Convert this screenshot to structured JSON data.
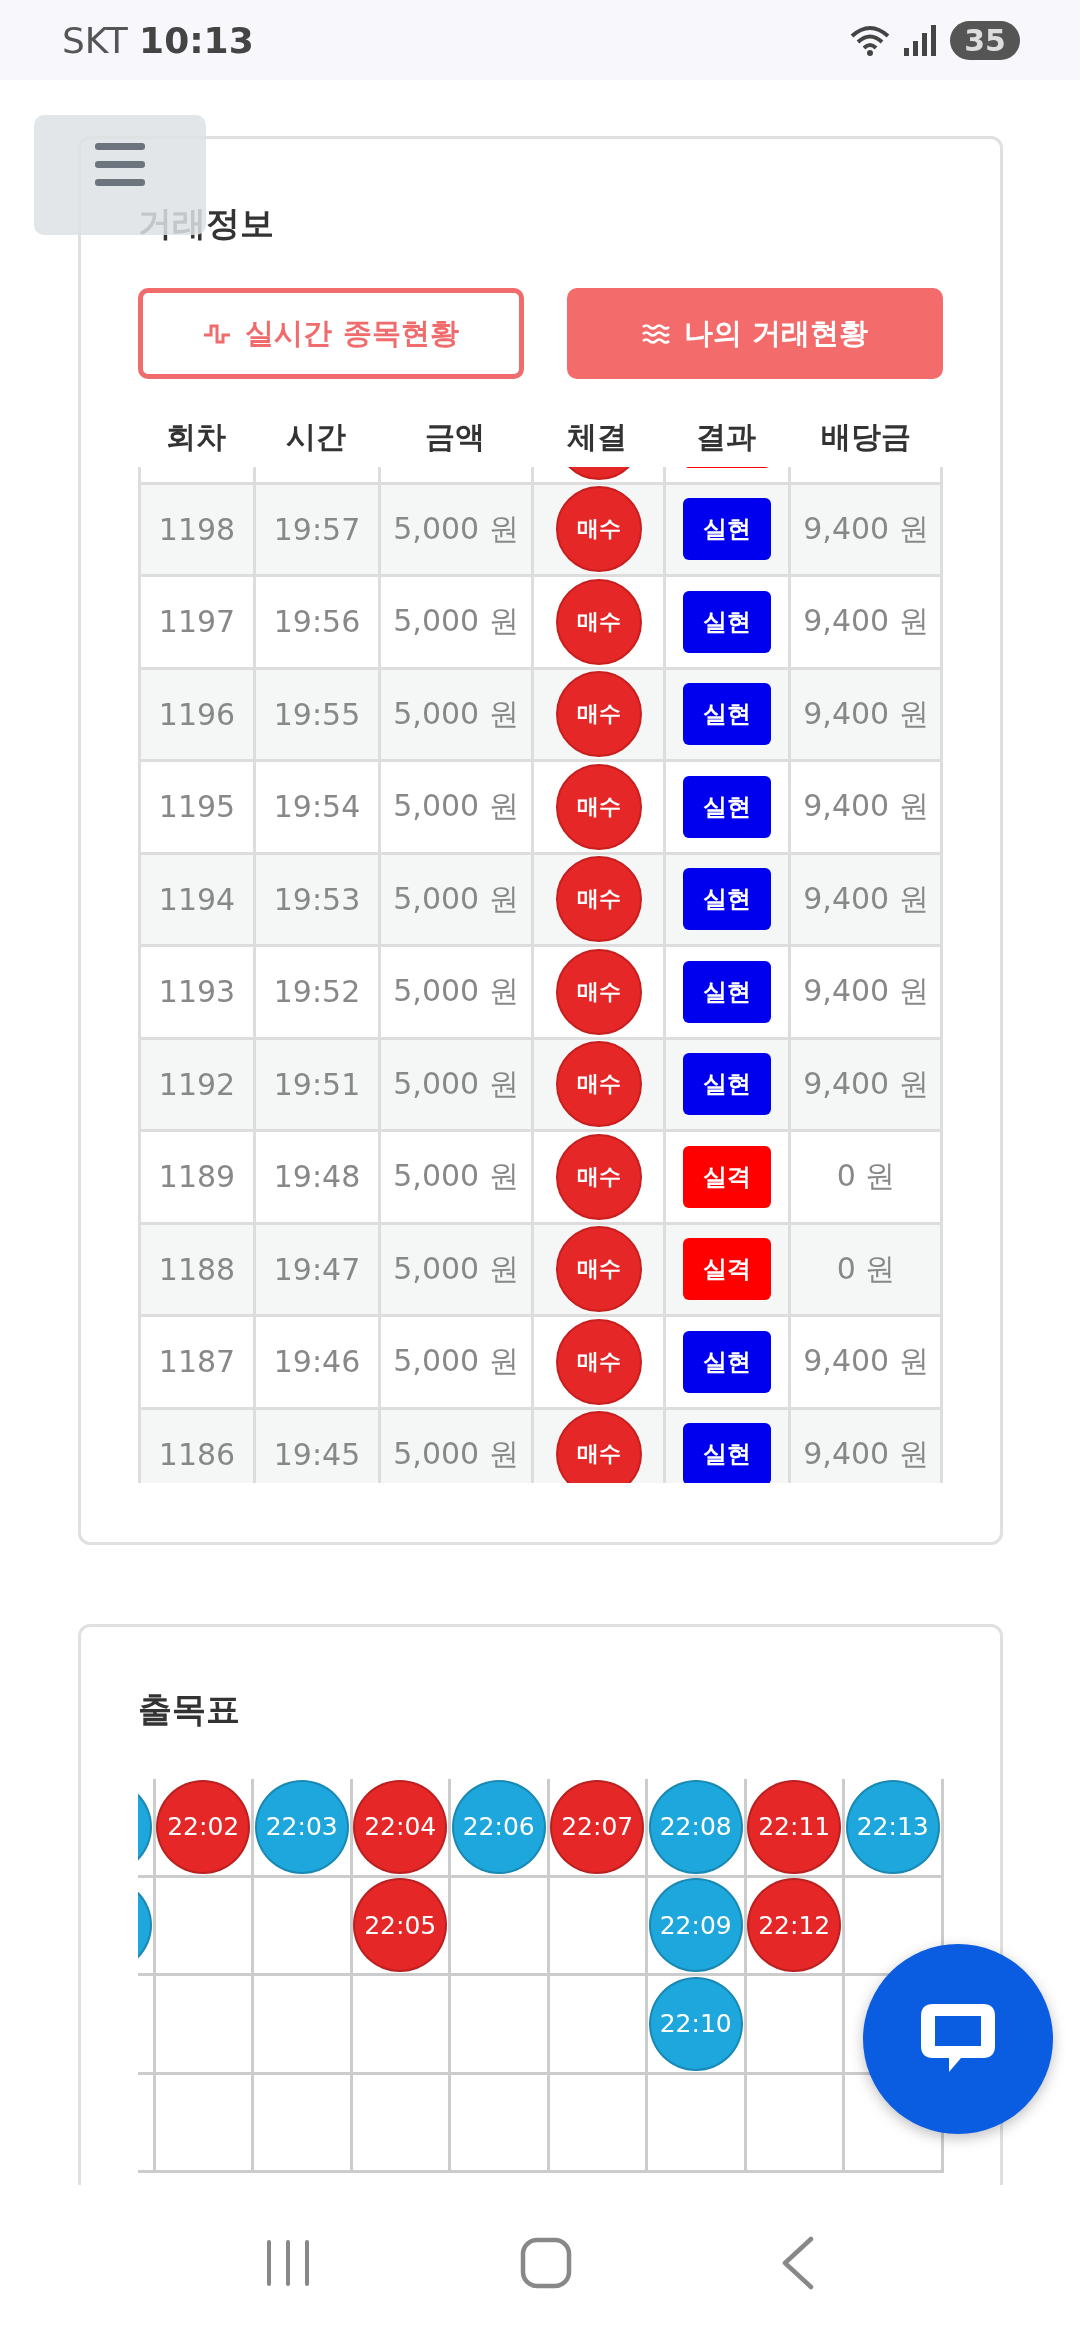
{
  "status_bar": {
    "carrier": "SKT",
    "time": "10:13",
    "battery": "35"
  },
  "trade_info": {
    "title": "거래정보",
    "tabs": [
      {
        "label": "실시간 종목현황",
        "selected": false
      },
      {
        "label": "나의 거래현황",
        "selected": true
      }
    ],
    "columns": [
      "회차",
      "시간",
      "금액",
      "체결",
      "결과",
      "배당금"
    ],
    "peek_row": {
      "color": "#ff0000"
    },
    "rows": [
      {
        "round": "1198",
        "time": "19:57",
        "amount": "5,000 원",
        "order": "매수",
        "result": "실현",
        "color": "#0000ee",
        "payout": "9,400 원"
      },
      {
        "round": "1197",
        "time": "19:56",
        "amount": "5,000 원",
        "order": "매수",
        "result": "실현",
        "color": "#0000ee",
        "payout": "9,400 원"
      },
      {
        "round": "1196",
        "time": "19:55",
        "amount": "5,000 원",
        "order": "매수",
        "result": "실현",
        "color": "#0000ee",
        "payout": "9,400 원"
      },
      {
        "round": "1195",
        "time": "19:54",
        "amount": "5,000 원",
        "order": "매수",
        "result": "실현",
        "color": "#0000ee",
        "payout": "9,400 원"
      },
      {
        "round": "1194",
        "time": "19:53",
        "amount": "5,000 원",
        "order": "매수",
        "result": "실현",
        "color": "#0000ee",
        "payout": "9,400 원"
      },
      {
        "round": "1193",
        "time": "19:52",
        "amount": "5,000 원",
        "order": "매수",
        "result": "실현",
        "color": "#0000ee",
        "payout": "9,400 원"
      },
      {
        "round": "1192",
        "time": "19:51",
        "amount": "5,000 원",
        "order": "매수",
        "result": "실현",
        "color": "#0000ee",
        "payout": "9,400 원"
      },
      {
        "round": "1189",
        "time": "19:48",
        "amount": "5,000 원",
        "order": "매수",
        "result": "실격",
        "color": "#ff0000",
        "payout": "0 원"
      },
      {
        "round": "1188",
        "time": "19:47",
        "amount": "5,000 원",
        "order": "매수",
        "result": "실격",
        "color": "#ff0000",
        "payout": "0 원"
      },
      {
        "round": "1187",
        "time": "19:46",
        "amount": "5,000 원",
        "order": "매수",
        "result": "실현",
        "color": "#0000ee",
        "payout": "9,400 원"
      },
      {
        "round": "1186",
        "time": "19:45",
        "amount": "5,000 원",
        "order": "매수",
        "result": "실현",
        "color": "#0000ee",
        "payout": "9,400 원"
      }
    ]
  },
  "result_board": {
    "title": "출목표",
    "columns": [
      [
        {
          "kind": "cut",
          "color": "#1ea7dc"
        },
        {
          "kind": "cut",
          "color": "#1ea7dc"
        }
      ],
      [
        {
          "kind": "full",
          "time": "22:02",
          "color": "#e52727"
        }
      ],
      [
        {
          "kind": "full",
          "time": "22:03",
          "color": "#1ea7dc"
        }
      ],
      [
        {
          "kind": "full",
          "time": "22:04",
          "color": "#e52727"
        },
        {
          "kind": "full",
          "time": "22:05",
          "color": "#e52727"
        }
      ],
      [
        {
          "kind": "full",
          "time": "22:06",
          "color": "#1ea7dc"
        }
      ],
      [
        {
          "kind": "full",
          "time": "22:07",
          "color": "#e52727"
        }
      ],
      [
        {
          "kind": "full",
          "time": "22:08",
          "color": "#1ea7dc"
        },
        {
          "kind": "full",
          "time": "22:09",
          "color": "#1ea7dc"
        },
        {
          "kind": "full",
          "time": "22:10",
          "color": "#1ea7dc"
        }
      ],
      [
        {
          "kind": "full",
          "time": "22:11",
          "color": "#e52727"
        },
        {
          "kind": "full",
          "time": "22:12",
          "color": "#e52727"
        }
      ],
      [
        {
          "kind": "full",
          "time": "22:13",
          "color": "#1ea7dc"
        }
      ]
    ]
  }
}
